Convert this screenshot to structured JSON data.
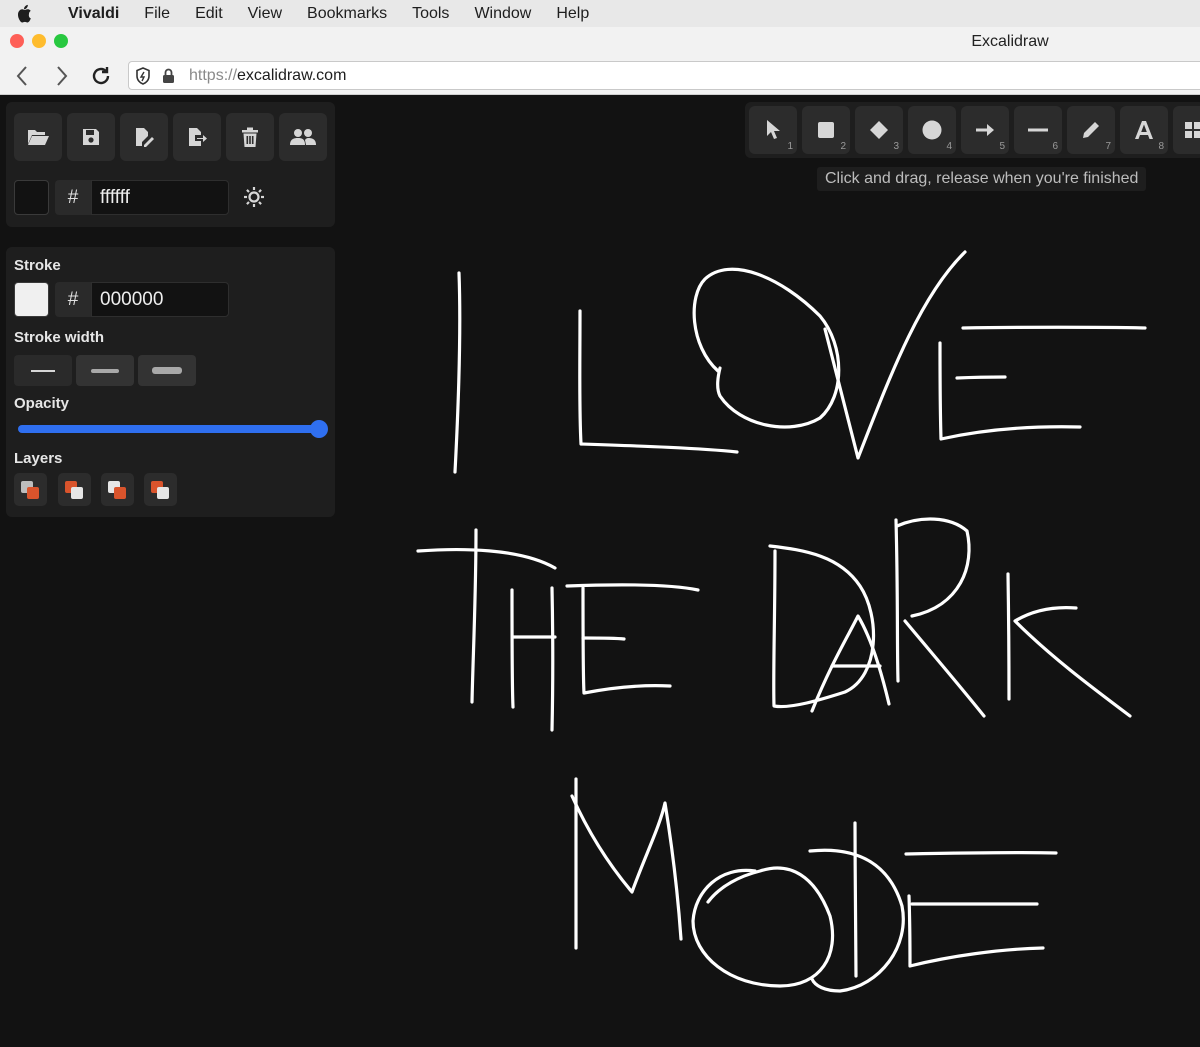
{
  "menubar": {
    "app": "Vivaldi",
    "items": [
      "File",
      "Edit",
      "View",
      "Bookmarks",
      "Tools",
      "Window",
      "Help"
    ]
  },
  "window": {
    "title": "Excalidraw"
  },
  "address": {
    "protocol": "https://",
    "host": "excalidraw.com"
  },
  "canvas_bg": {
    "hex": "ffffff"
  },
  "stroke": {
    "label": "Stroke",
    "hex": "000000"
  },
  "stroke_width": {
    "label": "Stroke width"
  },
  "opacity": {
    "label": "Opacity",
    "value_percent": 100
  },
  "layers": {
    "label": "Layers"
  },
  "tools": [
    {
      "name": "selection",
      "num": "1"
    },
    {
      "name": "rectangle",
      "num": "2"
    },
    {
      "name": "diamond",
      "num": "3"
    },
    {
      "name": "ellipse",
      "num": "4"
    },
    {
      "name": "arrow",
      "num": "5"
    },
    {
      "name": "line",
      "num": "6"
    },
    {
      "name": "draw",
      "num": "7"
    },
    {
      "name": "text",
      "num": "8"
    }
  ],
  "hint": "Click and drag, release when you're finished",
  "colors": {
    "accent": "#2f6ff0",
    "canvas": "#121212",
    "panel": "#1e1e1e",
    "layer_orange": "#d9542c"
  }
}
